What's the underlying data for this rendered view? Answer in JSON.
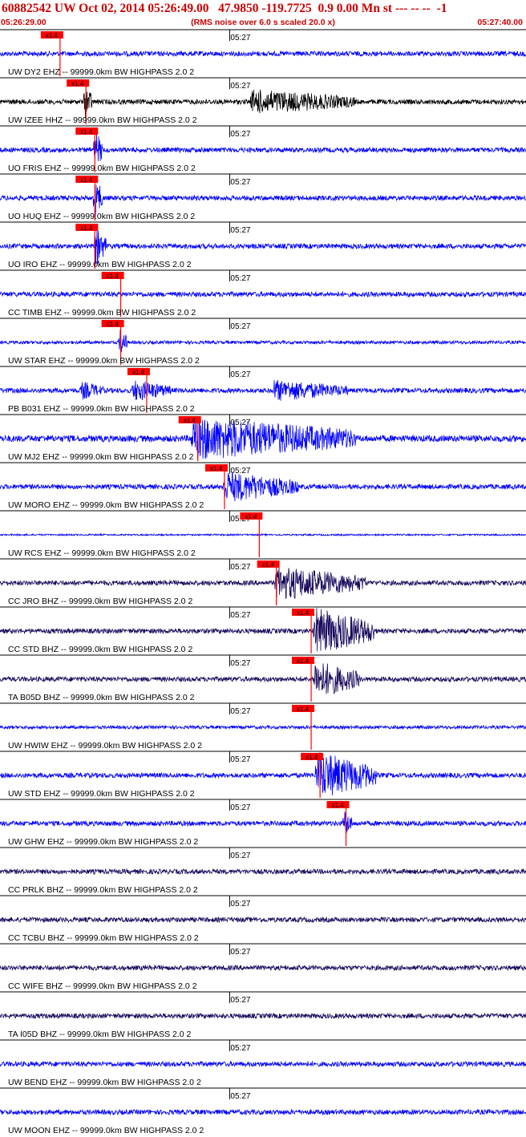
{
  "header": {
    "title": "60882542 UW Oct 02, 2014 05:26:49.00   47.9850 -119.7725  0.9 0.00 Mn st --- -- --  -1",
    "start_time": "05:26:29.00",
    "noise_note": "(RMS noise over 6.0 s scaled 20.0 x)",
    "end_time": "05:27:40.00"
  },
  "colors": {
    "title_red": "#cc0000",
    "pick_red": "#ff0000",
    "blue": "#0000ff",
    "black": "#000000",
    "purple": "#1a0a5c"
  },
  "chart_data": {
    "type": "line",
    "x_axis": {
      "start": "05:26:29.00",
      "end": "05:27:40.00",
      "tick_label": "05:27"
    },
    "pick_label": "x1.4",
    "series": [
      {
        "station": "UW DY2 EHZ -- 99999.0km BW  HIGHPASS  2.0  2",
        "color": "blue",
        "pick_time": "05:26:37.1",
        "noise": 3,
        "events": []
      },
      {
        "station": "UW IZEE HHZ -- 99999.0km BW  HIGHPASS  2.0  2",
        "color": "black",
        "pick_time": "05:26:40.6",
        "noise": 3,
        "events": [
          {
            "t": "05:26:40.5",
            "amp": 22,
            "dur": 1
          },
          {
            "t": "05:27:03.0",
            "amp": 16,
            "dur": 14
          }
        ]
      },
      {
        "station": "UO FRIS EHZ -- 99999.0km BW  HIGHPASS  2.0  2",
        "color": "blue",
        "pick_time": "05:26:41.8",
        "noise": 3,
        "events": [
          {
            "t": "05:26:41.8",
            "amp": 26,
            "dur": 1
          }
        ]
      },
      {
        "station": "UO HUQ EHZ -- 99999.0km BW  HIGHPASS  2.0  2",
        "color": "blue",
        "pick_time": "05:26:41.8",
        "noise": 3,
        "events": [
          {
            "t": "05:26:41.8",
            "amp": 26,
            "dur": 1
          }
        ]
      },
      {
        "station": "UO IRO EHZ -- 99999.0km BW  HIGHPASS  2.0  2",
        "color": "blue",
        "pick_time": "05:26:41.8",
        "noise": 3,
        "events": [
          {
            "t": "05:26:41.8",
            "amp": 26,
            "dur": 1.5
          }
        ]
      },
      {
        "station": "CC TIMB EHZ -- 99999.0km BW  HIGHPASS  2.0  2",
        "color": "blue",
        "pick_time": "05:26:45.3",
        "noise": 3,
        "events": []
      },
      {
        "station": "UW STAR EHZ -- 99999.0km BW  HIGHPASS  2.0  2",
        "color": "blue",
        "pick_time": "05:26:45.3",
        "noise": 2,
        "events": [
          {
            "t": "05:26:45.2",
            "amp": 18,
            "dur": 1
          }
        ]
      },
      {
        "station": "PB B031 EHZ -- 99999.0km BW  HIGHPASS  2.0  2",
        "color": "blue",
        "pick_time": "05:26:48.8",
        "noise": 3,
        "events": [
          {
            "t": "05:26:40.0",
            "amp": 12,
            "dur": 3
          },
          {
            "t": "05:26:47.0",
            "amp": 14,
            "dur": 5
          },
          {
            "t": "05:27:06.0",
            "amp": 14,
            "dur": 10
          }
        ]
      },
      {
        "station": "UW MJ2 EHZ -- 99999.0km BW  HIGHPASS  2.0  2",
        "color": "blue",
        "pick_time": "05:26:55.7",
        "noise": 4,
        "events": [
          {
            "t": "05:26:55.0",
            "amp": 28,
            "dur": 22
          }
        ]
      },
      {
        "station": "UW MORO EHZ -- 99999.0km BW  HIGHPASS  2.0  2",
        "color": "blue",
        "pick_time": "05:26:59.3",
        "noise": 3,
        "events": [
          {
            "t": "05:26:59.3",
            "amp": 20,
            "dur": 10
          }
        ]
      },
      {
        "station": "UW RCS EHZ -- 99999.0km BW  HIGHPASS  2.0  2",
        "color": "blue",
        "pick_time": "05:27:04.0",
        "noise": 1,
        "events": []
      },
      {
        "station": "CC JRO BHZ -- 99999.0km BW  HIGHPASS  2.0  2",
        "color": "purple",
        "pick_time": "05:27:06.3",
        "noise": 3,
        "events": [
          {
            "t": "05:27:06.3",
            "amp": 22,
            "dur": 12
          }
        ]
      },
      {
        "station": "CC STD BHZ -- 99999.0km BW  HIGHPASS  2.0  2",
        "color": "purple",
        "pick_time": "05:27:11.0",
        "noise": 3,
        "events": [
          {
            "t": "05:27:11.5",
            "amp": 30,
            "dur": 8
          }
        ]
      },
      {
        "station": "TA B05D BHZ -- 99999.0km BW  HIGHPASS  2.0  2",
        "color": "purple",
        "pick_time": "05:27:11.0",
        "noise": 3,
        "events": [
          {
            "t": "05:27:11.5",
            "amp": 24,
            "dur": 6
          }
        ]
      },
      {
        "station": "UW HWIW EHZ -- 99999.0km BW  HIGHPASS  2.0  2",
        "color": "blue",
        "pick_time": "05:27:11.0",
        "noise": 2,
        "events": []
      },
      {
        "station": "UW STD EHZ -- 99999.0km BW  HIGHPASS  2.0  2",
        "color": "blue",
        "pick_time": "05:27:12.2",
        "noise": 3,
        "events": [
          {
            "t": "05:27:11.8",
            "amp": 30,
            "dur": 8
          }
        ]
      },
      {
        "station": "UW GHW EHZ -- 99999.0km BW  HIGHPASS  2.0  2",
        "color": "blue",
        "pick_time": "05:27:15.7",
        "noise": 3,
        "events": [
          {
            "t": "05:27:15.5",
            "amp": 18,
            "dur": 1
          }
        ]
      },
      {
        "station": "CC PRLK BHZ -- 99999.0km BW  HIGHPASS  2.0  2",
        "color": "purple",
        "pick_time": null,
        "noise": 3,
        "events": []
      },
      {
        "station": "CC TCBU BHZ -- 99999.0km BW  HIGHPASS  2.0  2",
        "color": "purple",
        "pick_time": null,
        "noise": 3,
        "events": []
      },
      {
        "station": "CC WIFE BHZ -- 99999.0km BW  HIGHPASS  2.0  2",
        "color": "purple",
        "pick_time": null,
        "noise": 3,
        "events": []
      },
      {
        "station": "TA I05D BHZ -- 99999.0km BW  HIGHPASS  2.0  2",
        "color": "purple",
        "pick_time": null,
        "noise": 3,
        "events": []
      },
      {
        "station": "UW BEND EHZ -- 99999.0km BW  HIGHPASS  2.0  2",
        "color": "blue",
        "pick_time": null,
        "noise": 3,
        "events": []
      },
      {
        "station": "UW MOON EHZ -- 99999.0km BW  HIGHPASS  2.0  2",
        "color": "blue",
        "pick_time": null,
        "noise": 3,
        "events": []
      }
    ]
  }
}
